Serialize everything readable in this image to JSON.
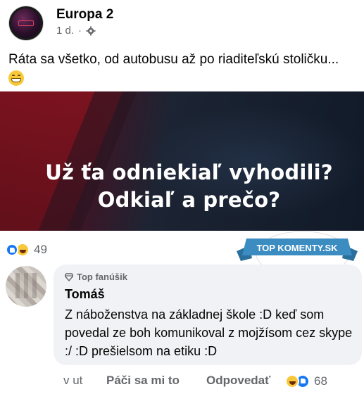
{
  "post": {
    "author": "Europa 2",
    "time": "1 d.",
    "separator": "·",
    "privacy_icon": "gear-icon",
    "text": "Ráta sa všetko, od autobusu až po riaditeľskú stoličku...",
    "text_emoji": "grin-emoji",
    "avatar_logo": "EUROPA 2"
  },
  "banner": {
    "line1": "Už ťa odniekiaľ vyhodili?",
    "line2": "Odkiaľ a prečo?"
  },
  "reactions": {
    "icons": [
      "like-icon",
      "haha-icon"
    ],
    "count": "49"
  },
  "watermark": {
    "text": "TOP KOMENTY.SK"
  },
  "comment": {
    "badge": "Top fanúšik",
    "author": "Tomáš",
    "text": "Z náboženstva na základnej škole :D keď som povedal ze boh komunikoval z mojžísom cez skype :/ :D prešielsom na etiku :D",
    "actions": {
      "time": "v ut",
      "like": "Páči sa mi to",
      "reply": "Odpovedať"
    },
    "reaction_count": "68"
  },
  "colors": {
    "accent": "#1877f2",
    "muted_text": "#65676b",
    "bubble_bg": "#f0f2f5",
    "badge_blue": "#3a8cc1"
  }
}
